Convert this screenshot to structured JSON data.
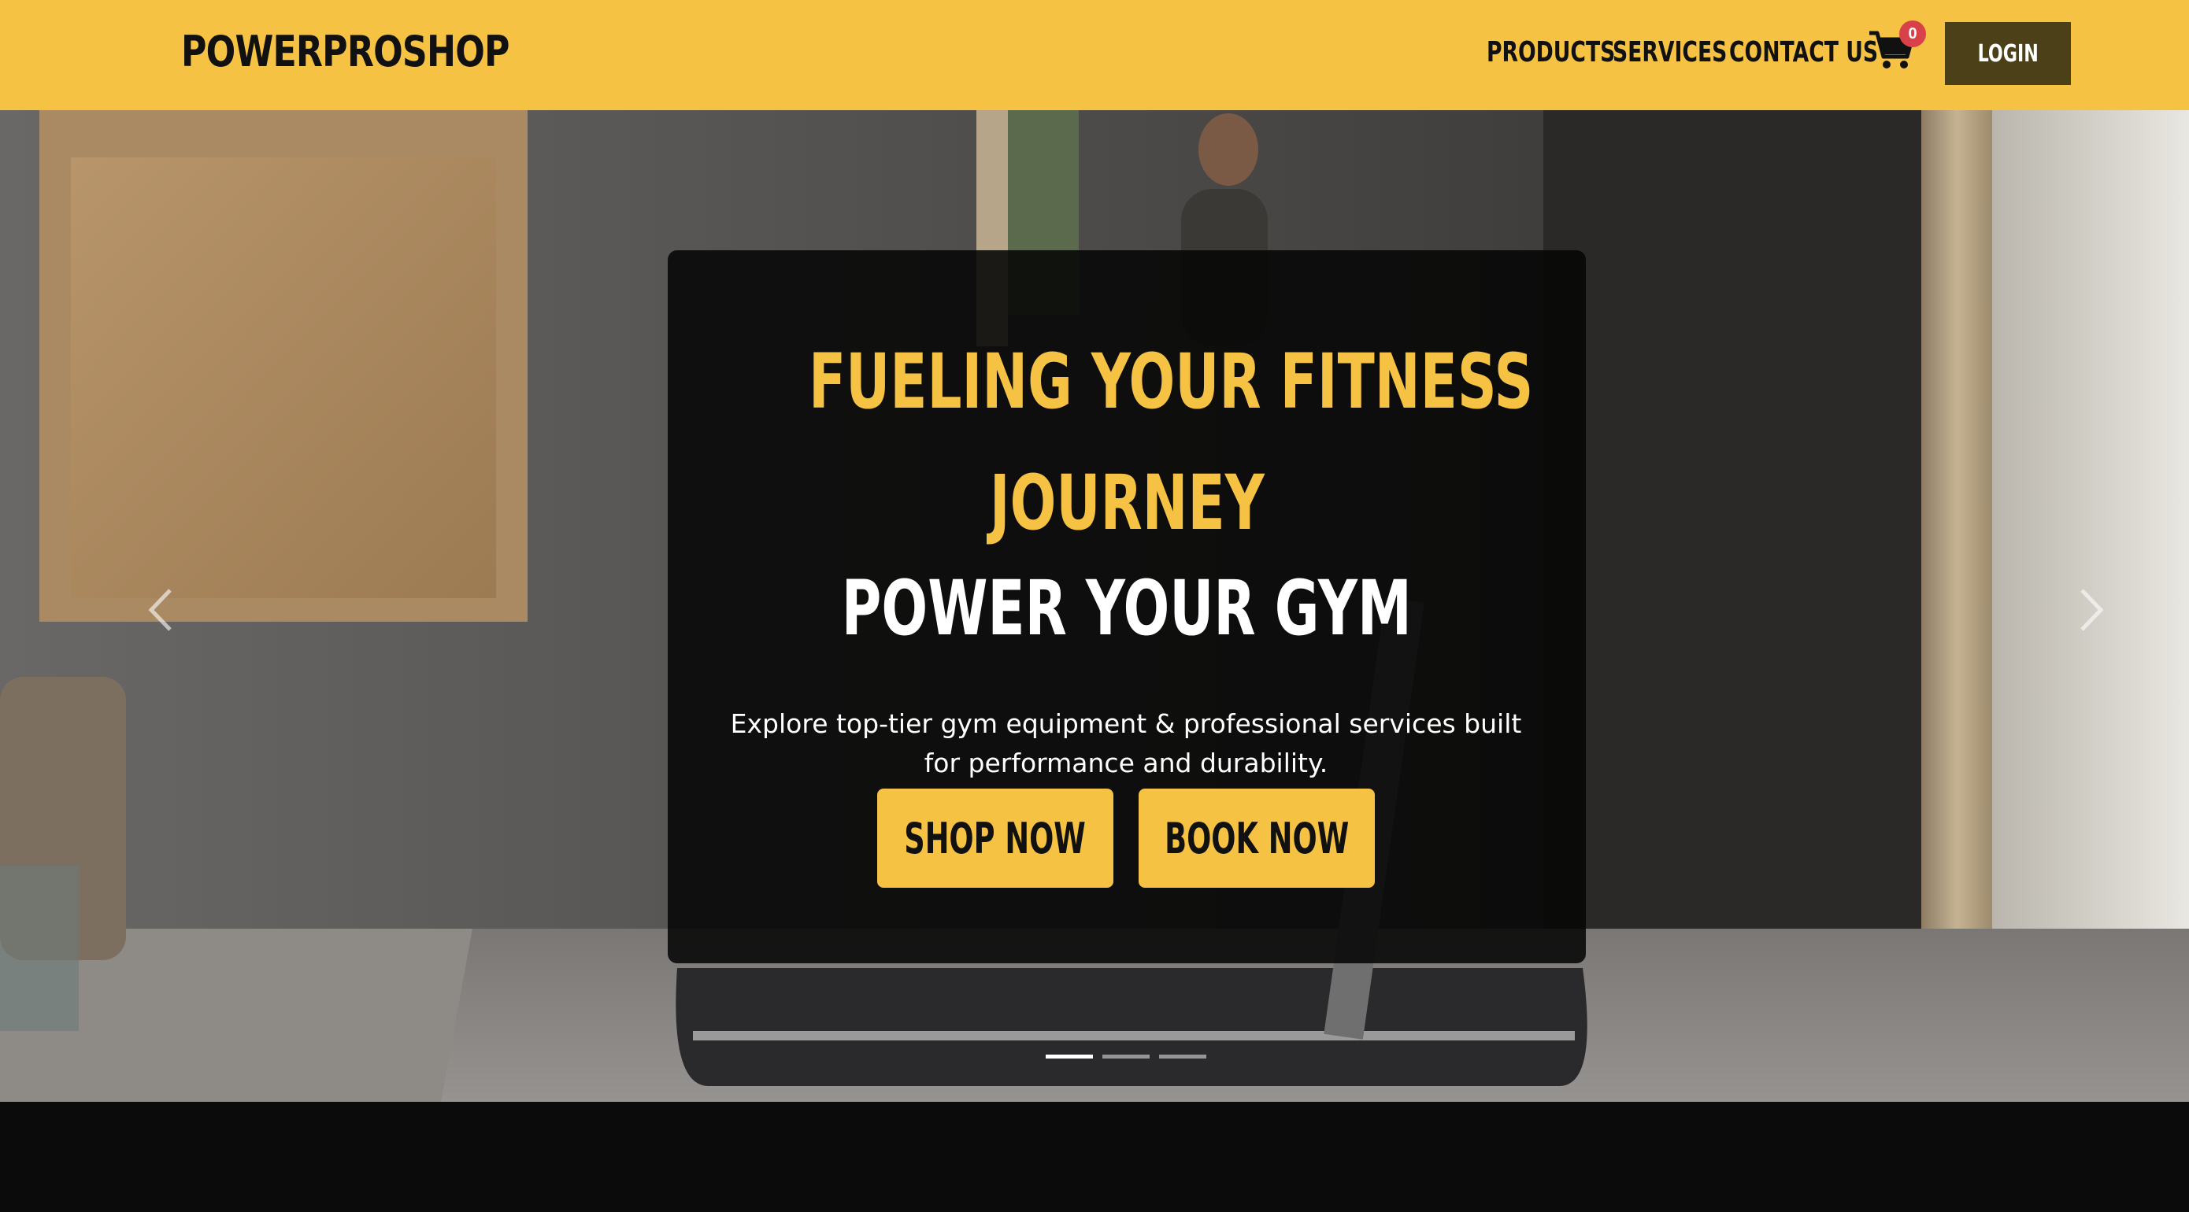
{
  "brand": {
    "name": "POWERPROSHOP"
  },
  "nav": {
    "products": "PRODUCTS",
    "services": "SERVICES",
    "contact": "CONTACT US",
    "cart_count": "0",
    "login": "LOGIN"
  },
  "hero": {
    "headline_line1": "FUELING YOUR FITNESS",
    "headline_line2": "JOURNEY",
    "headline_line3": "POWER YOUR GYM",
    "description": "Explore top-tier gym equipment & professional services built for performance and durability.",
    "shop_button": "SHOP NOW",
    "book_button": "BOOK NOW",
    "slide_count": 3,
    "active_slide": 1
  },
  "colors": {
    "accent": "#f5c243",
    "login_bg": "#4b4017",
    "badge": "#d9414a",
    "footer_bg": "#0b0b0c"
  },
  "icons": {
    "cart": "shopping-cart-icon",
    "prev": "chevron-left-icon",
    "next": "chevron-right-icon"
  }
}
